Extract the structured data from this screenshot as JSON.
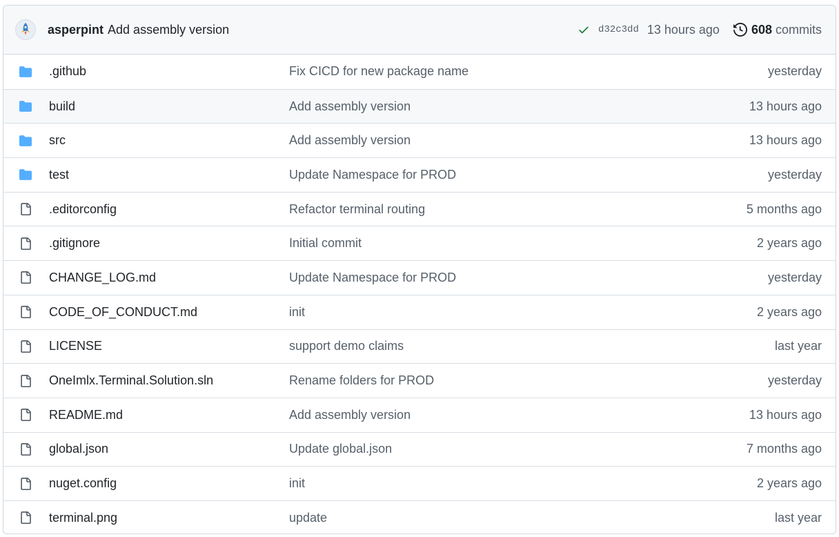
{
  "latest_commit": {
    "author": "asperpint",
    "message": "Add assembly version",
    "status_icon": "check-icon",
    "sha": "d32c3dd",
    "time": "13 hours ago",
    "commit_count": "608",
    "commit_label": "commits"
  },
  "colors": {
    "folder": "#54aeff",
    "file": "#57606a",
    "check": "#1a7f37"
  },
  "files": [
    {
      "type": "folder",
      "name": ".github",
      "message": "Fix CICD for new package name",
      "age": "yesterday"
    },
    {
      "type": "folder",
      "name": "build",
      "message": "Add assembly version",
      "age": "13 hours ago"
    },
    {
      "type": "folder",
      "name": "src",
      "message": "Add assembly version",
      "age": "13 hours ago"
    },
    {
      "type": "folder",
      "name": "test",
      "message": "Update Namespace for PROD",
      "age": "yesterday"
    },
    {
      "type": "file",
      "name": ".editorconfig",
      "message": "Refactor terminal routing",
      "age": "5 months ago"
    },
    {
      "type": "file",
      "name": ".gitignore",
      "message": "Initial commit",
      "age": "2 years ago"
    },
    {
      "type": "file",
      "name": "CHANGE_LOG.md",
      "message": "Update Namespace for PROD",
      "age": "yesterday"
    },
    {
      "type": "file",
      "name": "CODE_OF_CONDUCT.md",
      "message": "init",
      "age": "2 years ago"
    },
    {
      "type": "file",
      "name": "LICENSE",
      "message": "support demo claims",
      "age": "last year"
    },
    {
      "type": "file",
      "name": "OneImlx.Terminal.Solution.sln",
      "message": "Rename folders for PROD",
      "age": "yesterday"
    },
    {
      "type": "file",
      "name": "README.md",
      "message": "Add assembly version",
      "age": "13 hours ago"
    },
    {
      "type": "file",
      "name": "global.json",
      "message": "Update global.json",
      "age": "7 months ago"
    },
    {
      "type": "file",
      "name": "nuget.config",
      "message": "init",
      "age": "2 years ago"
    },
    {
      "type": "file",
      "name": "terminal.png",
      "message": "update",
      "age": "last year"
    }
  ]
}
